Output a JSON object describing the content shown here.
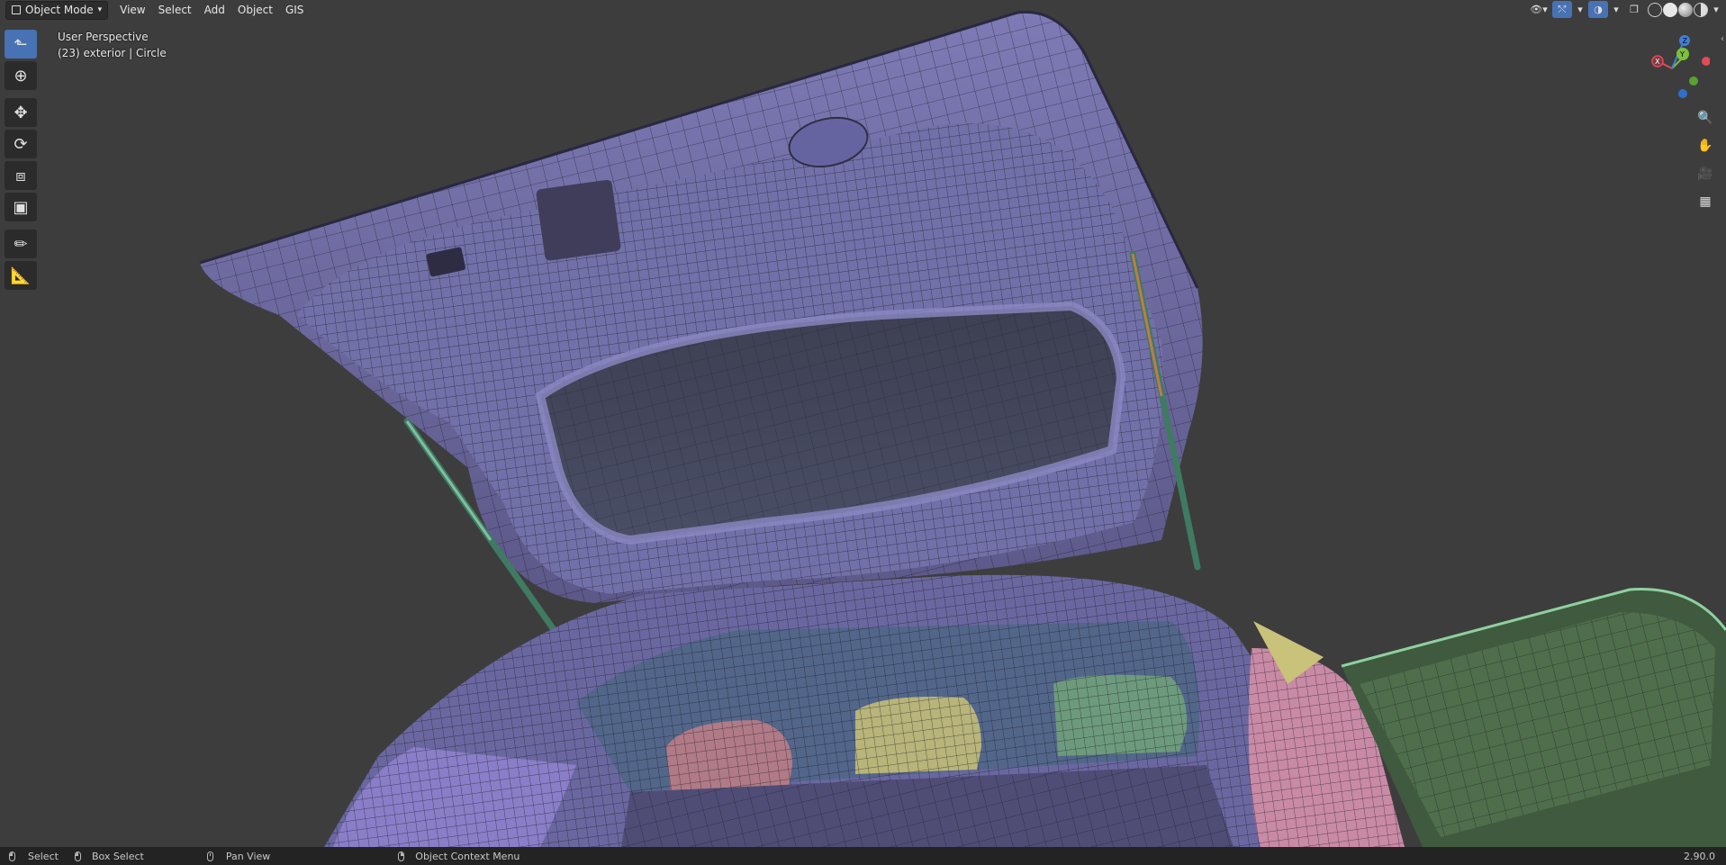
{
  "header": {
    "mode": "Object Mode",
    "menu": [
      "View",
      "Select",
      "Add",
      "Object",
      "GIS"
    ],
    "right_icons": [
      "visibility-icon",
      "gizmo-icon",
      "overlay-icon",
      "xray-icon",
      "wireframe-shading-icon",
      "solid-shading-icon",
      "material-shading-icon",
      "rendered-shading-icon"
    ]
  },
  "overlay": {
    "view_name": "User Perspective",
    "object_info": "(23) exterior  | Circle"
  },
  "toolbar": {
    "tools": [
      "select-box",
      "cursor",
      "move",
      "rotate",
      "scale",
      "transform",
      "annotate",
      "measure"
    ]
  },
  "gizmo": {
    "axes": [
      "X",
      "Y",
      "Z"
    ],
    "colors": {
      "x": "#e24b57",
      "y": "#7cbf3b",
      "z": "#3f7fdc"
    }
  },
  "navigation": [
    "zoom",
    "pan",
    "camera",
    "ortho-grid"
  ],
  "statusbar": {
    "select": "Select",
    "box_select": "Box Select",
    "pan_view": "Pan View",
    "context_menu": "Object Context Menu",
    "version": "2.90.0"
  },
  "colors": {
    "viewport_bg": "#3d3d3d",
    "mesh_purple": "#6d6a9e",
    "mesh_pink": "#c98aa6",
    "mesh_green": "#4f6a4b",
    "mesh_teal": "#6b8fa3",
    "mesh_yellow": "#b8b47a",
    "accent": "#4772b3"
  }
}
